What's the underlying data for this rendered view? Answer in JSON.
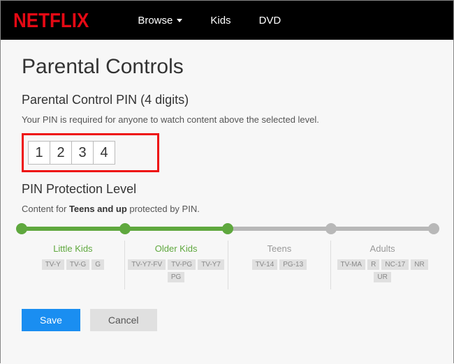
{
  "header": {
    "logo": "NETFLIX",
    "nav": {
      "browse": "Browse",
      "kids": "Kids",
      "dvd": "DVD"
    }
  },
  "page": {
    "title": "Parental Controls",
    "pin_label": "Parental Control PIN (4 digits)",
    "pin_help": "Your PIN is required for anyone to watch content above the selected level.",
    "pin": [
      "1",
      "2",
      "3",
      "4"
    ],
    "level_heading": "PIN Protection Level",
    "protection_prefix": "Content for ",
    "protection_bold": "Teens and up",
    "protection_suffix": " protected by PIN."
  },
  "levels": [
    {
      "label": "Little Kids",
      "active": true,
      "ratings": [
        "TV-Y",
        "TV-G",
        "G"
      ]
    },
    {
      "label": "Older Kids",
      "active": true,
      "ratings": [
        "TV-Y7-FV",
        "TV-PG",
        "TV-Y7",
        "PG"
      ]
    },
    {
      "label": "Teens",
      "active": false,
      "ratings": [
        "TV-14",
        "PG-13"
      ]
    },
    {
      "label": "Adults",
      "active": false,
      "ratings": [
        "TV-MA",
        "R",
        "NC-17",
        "NR",
        "UR"
      ]
    }
  ],
  "buttons": {
    "save": "Save",
    "cancel": "Cancel"
  }
}
